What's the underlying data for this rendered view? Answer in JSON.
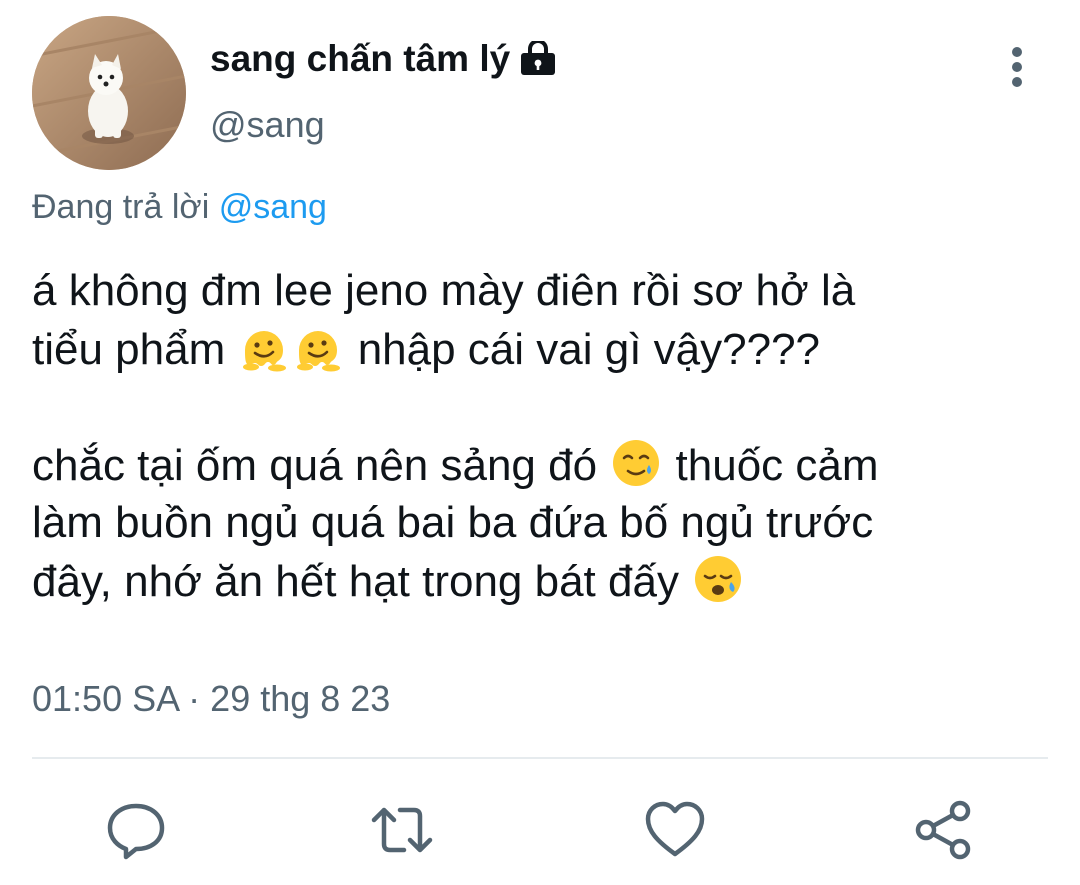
{
  "author": {
    "display_name": "sang chấn tâm lý",
    "handle": "@sang",
    "protected_icon": "lock-icon",
    "avatar": "white-dog-photo"
  },
  "reply": {
    "prefix": "Đang trả lời",
    "mention": "@sang"
  },
  "tweet": {
    "line1": "á không đm lee jeno mày điên rồi sơ hở là",
    "line2_a": "tiểu phẩm ",
    "line2_emojis": [
      "melting-face-emoji",
      "melting-face-emoji"
    ],
    "line2_b": " nhập cái vai gì vậy????",
    "line3_a": "chắc tại ốm quá nên sảng đó ",
    "line3_emoji": "face-holding-back-tears-emoji",
    "line3_b": " thuốc cảm",
    "line4": "làm buồn ngủ quá bai ba đứa bố ngủ trước",
    "line5_a": "đây, nhớ ăn hết hạt trong bát đấy ",
    "line5_emoji": "sleepy-face-emoji"
  },
  "timestamp": {
    "time": "01:50 SA",
    "separator": "·",
    "date": "29 thg 8 23"
  },
  "actions": [
    "reply-icon",
    "retweet-icon",
    "like-icon",
    "share-icon"
  ],
  "colors": {
    "text": "#0f1419",
    "secondary": "#536471",
    "link": "#1d9bf0",
    "emoji_yellow": "#ffcc33"
  }
}
